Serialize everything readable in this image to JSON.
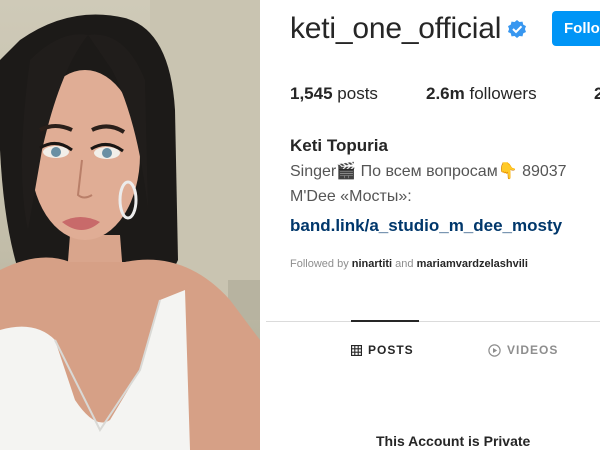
{
  "profile": {
    "username": "keti_one_official",
    "follow_label": "Follow",
    "stats": {
      "posts_count": "1,545",
      "posts_label": "posts",
      "followers_count": "2.6m",
      "followers_label": "followers",
      "following_count": "2"
    },
    "full_name": "Keti Topuria",
    "bio_line1": "Singer🎬 По всем вопросам👇 89037",
    "bio_line2": "M'Dee «Мосты»:",
    "bio_link": "band.link/a_studio_m_dee_mosty",
    "followed_by": {
      "prefix": "Followed by",
      "user1": "ninartiti",
      "joiner": "and",
      "user2": "mariamvardzelashvili"
    }
  },
  "tabs": [
    {
      "label": "POSTS",
      "icon": "grid-icon",
      "active": true
    },
    {
      "label": "VIDEOS",
      "icon": "play-circle-icon",
      "active": false
    }
  ],
  "private_notice": "This Account is Private",
  "colors": {
    "follow_button": "#0095f6",
    "verified_badge": "#3897f0",
    "link": "#00376b",
    "muted": "#8e8e8e"
  }
}
